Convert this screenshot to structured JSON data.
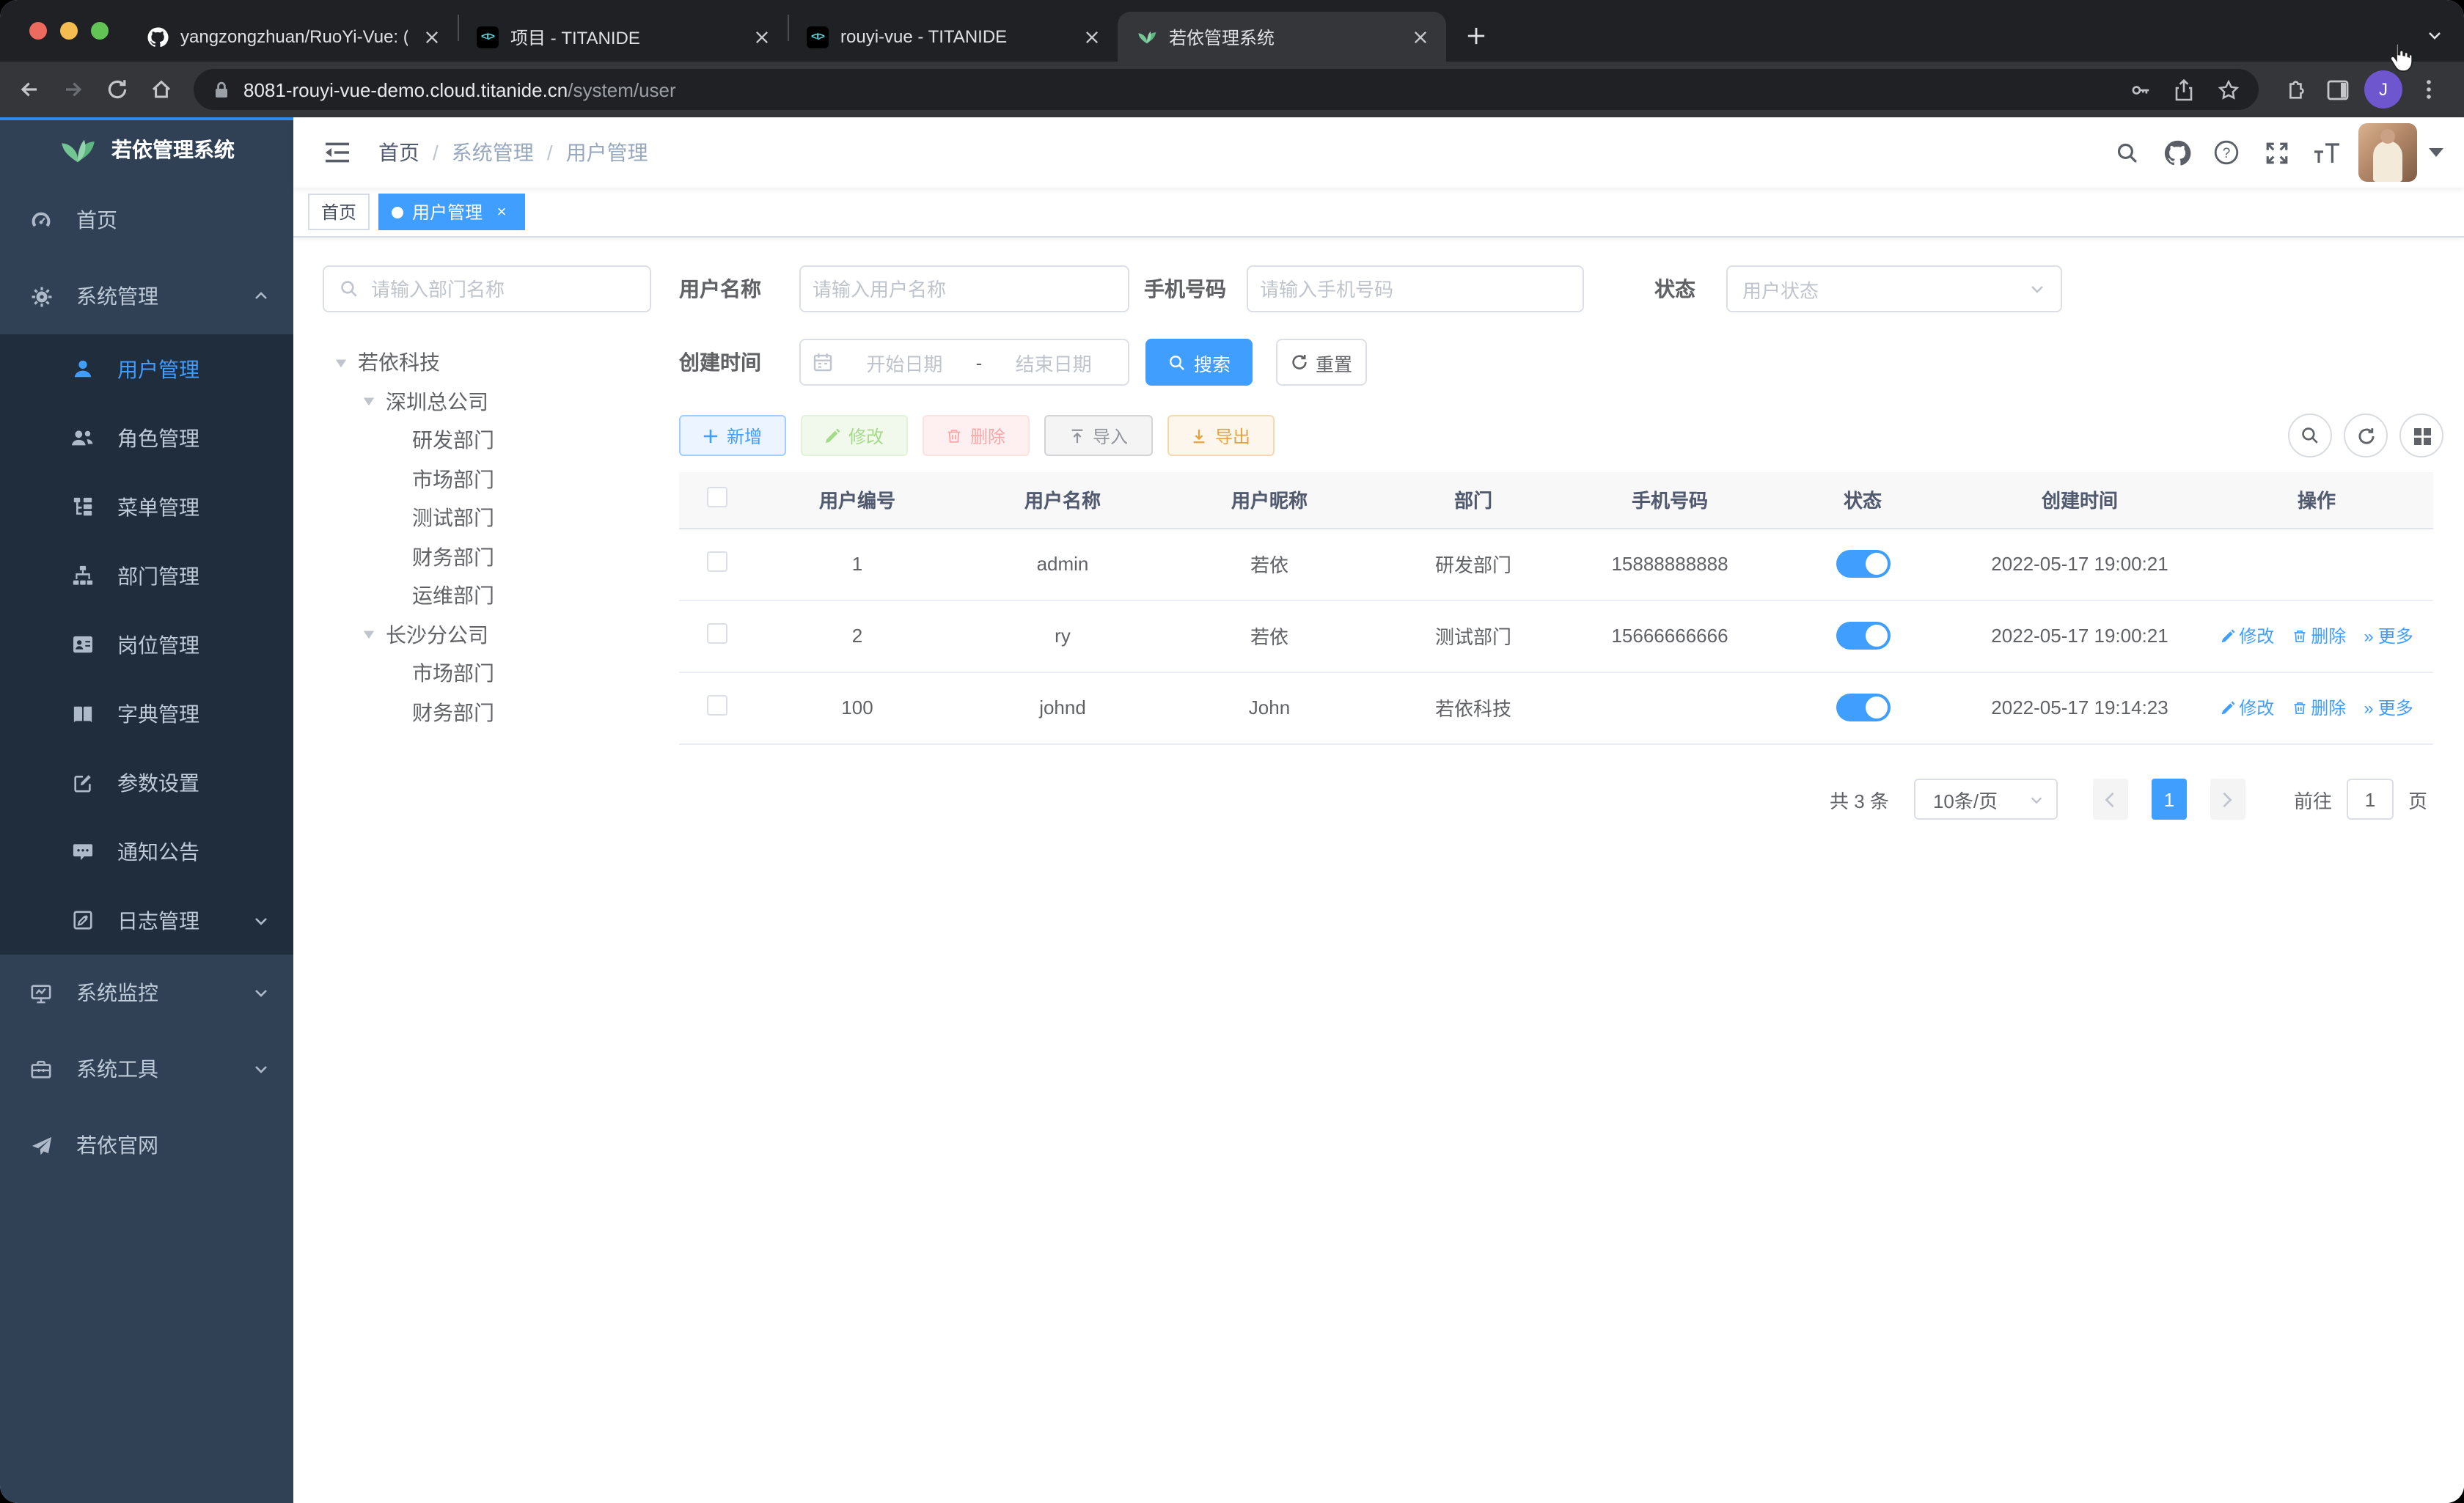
{
  "browser": {
    "tabs": [
      {
        "title": "yangzongzhuan/RuoYi-Vue: (Ru",
        "favicon": "github"
      },
      {
        "title": "项目 - TITANIDE",
        "favicon": "titanide"
      },
      {
        "title": "rouyi-vue - TITANIDE",
        "favicon": "titanide"
      },
      {
        "title": "若依管理系统",
        "favicon": "ruoyi-leaf"
      }
    ],
    "titanide_glyph": "<t>",
    "url_host": "8081-rouyi-vue-demo.cloud.titanide.cn",
    "url_path": "/system/user",
    "profile_initial": "J"
  },
  "sidebar": {
    "logo_title": "若依管理系统",
    "items": [
      {
        "label": "首页"
      },
      {
        "label": "系统管理"
      },
      {
        "label": "用户管理"
      },
      {
        "label": "角色管理"
      },
      {
        "label": "菜单管理"
      },
      {
        "label": "部门管理"
      },
      {
        "label": "岗位管理"
      },
      {
        "label": "字典管理"
      },
      {
        "label": "参数设置"
      },
      {
        "label": "通知公告"
      },
      {
        "label": "日志管理"
      },
      {
        "label": "系统监控"
      },
      {
        "label": "系统工具"
      },
      {
        "label": "若依官网"
      }
    ]
  },
  "navbar": {
    "breadcrumb": [
      "首页",
      "系统管理",
      "用户管理"
    ],
    "separator": "/"
  },
  "tags": [
    {
      "label": "首页"
    },
    {
      "label": "用户管理"
    }
  ],
  "dept_panel": {
    "search_placeholder": "请输入部门名称",
    "tree": [
      {
        "label": "若依科技"
      },
      {
        "label": "深圳总公司"
      },
      {
        "label": "研发部门"
      },
      {
        "label": "市场部门"
      },
      {
        "label": "测试部门"
      },
      {
        "label": "财务部门"
      },
      {
        "label": "运维部门"
      },
      {
        "label": "长沙分公司"
      },
      {
        "label": "市场部门"
      },
      {
        "label": "财务部门"
      }
    ]
  },
  "filters": {
    "username_label": "用户名称",
    "username_placeholder": "请输入用户名称",
    "phone_label": "手机号码",
    "phone_placeholder": "请输入手机号码",
    "status_label": "状态",
    "status_placeholder": "用户状态",
    "created_label": "创建时间",
    "date_start_placeholder": "开始日期",
    "date_separator": "-",
    "date_end_placeholder": "结束日期",
    "search_button": "搜索",
    "reset_button": "重置"
  },
  "toolbar": {
    "add": "新增",
    "edit": "修改",
    "delete": "删除",
    "import": "导入",
    "export": "导出"
  },
  "table": {
    "columns": [
      "用户编号",
      "用户名称",
      "用户昵称",
      "部门",
      "手机号码",
      "状态",
      "创建时间",
      "操作"
    ],
    "op_edit": "修改",
    "op_delete": "删除",
    "op_more": "更多",
    "op_more_glyph": "»",
    "rows": [
      {
        "id": "1",
        "username": "admin",
        "nickname": "若依",
        "dept": "研发部门",
        "phone": "15888888888",
        "created": "2022-05-17 19:00:21"
      },
      {
        "id": "2",
        "username": "ry",
        "nickname": "若依",
        "dept": "测试部门",
        "phone": "15666666666",
        "created": "2022-05-17 19:00:21"
      },
      {
        "id": "100",
        "username": "johnd",
        "nickname": "John",
        "dept": "若依科技",
        "phone": "",
        "created": "2022-05-17 19:14:23"
      }
    ]
  },
  "pagination": {
    "total_text": "共 3 条",
    "page_size": "10条/页",
    "current_page": "1",
    "goto_label": "前往",
    "goto_value": "1",
    "page_unit": "页"
  },
  "colors": {
    "primary": "#409eff",
    "sidebar_bg": "#304156",
    "submenu_bg": "#1f2d3d"
  }
}
